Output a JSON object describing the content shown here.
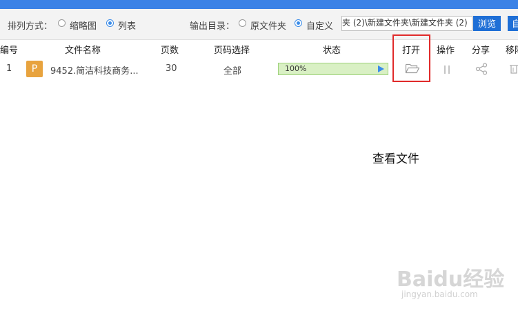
{
  "toolbar": {
    "sort_label": "排列方式：",
    "sort_options": [
      {
        "label": "缩略图",
        "checked": false
      },
      {
        "label": "列表",
        "checked": true
      }
    ],
    "output_label": "输出目录：",
    "output_options": [
      {
        "label": "原文件夹",
        "checked": false
      },
      {
        "label": "自定义",
        "checked": true
      }
    ],
    "output_path": "夹 (2)\\新建文件夹\\新建文件夹 (2)",
    "browse_label": "浏览",
    "extra_button_label": "自"
  },
  "table": {
    "headers": [
      "编号",
      "文件名称",
      "页数",
      "页码选择",
      "状态",
      "打开",
      "操作",
      "分享",
      "移除"
    ],
    "rows": [
      {
        "index": "1",
        "file_icon_letter": "P",
        "file_name": "9452.简洁科技商务...",
        "pages": "30",
        "page_selection": "全部",
        "progress_text": "100%",
        "progress": 1.0
      }
    ]
  },
  "annotation": {
    "caption": "查看文件"
  },
  "watermark": {
    "text": "Baidu经验",
    "sub": "jingyan.baidu.com"
  },
  "colors": {
    "accent": "#3b82e6",
    "button": "#1f6fd6",
    "highlight": "#e02a2a",
    "file_icon": "#e8a33e",
    "progress_fill": "#e4f5d4"
  },
  "icons": {
    "open": "folder-open-icon",
    "operate": "pause-icon",
    "share": "share-icon",
    "remove": "trash-icon"
  }
}
